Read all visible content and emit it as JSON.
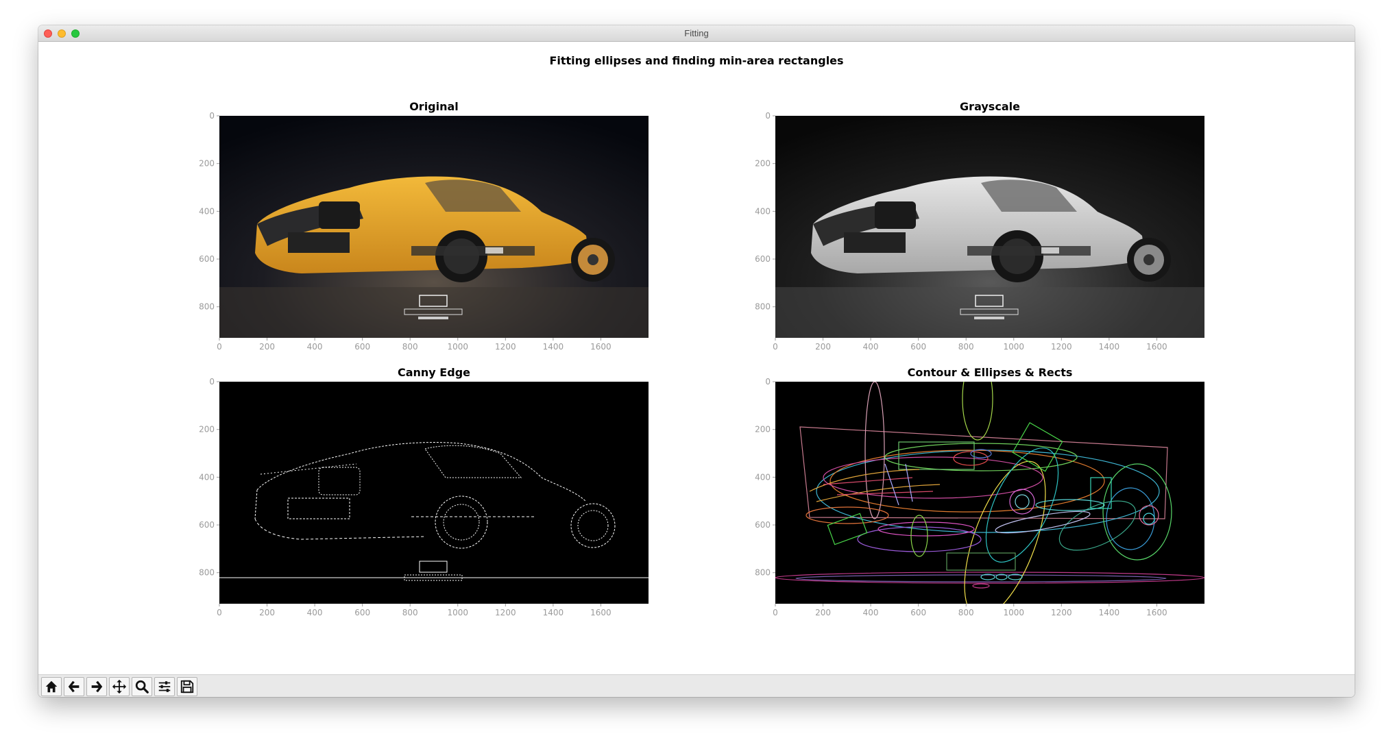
{
  "window": {
    "title": "Fitting"
  },
  "figure": {
    "suptitle": "Fitting ellipses and finding min-area rectangles"
  },
  "axes": [
    {
      "title": "Original",
      "xticks": [
        "0",
        "200",
        "400",
        "600",
        "800",
        "1000",
        "1200",
        "1400",
        "1600"
      ],
      "yticks": [
        "0",
        "200",
        "400",
        "600",
        "800"
      ]
    },
    {
      "title": "Grayscale",
      "xticks": [
        "0",
        "200",
        "400",
        "600",
        "800",
        "1000",
        "1200",
        "1400",
        "1600"
      ],
      "yticks": [
        "0",
        "200",
        "400",
        "600",
        "800"
      ]
    },
    {
      "title": "Canny Edge",
      "xticks": [
        "0",
        "200",
        "400",
        "600",
        "800",
        "1000",
        "1200",
        "1400",
        "1600"
      ],
      "yticks": [
        "0",
        "200",
        "400",
        "600",
        "800"
      ]
    },
    {
      "title": "Contour & Ellipses & Rects",
      "xticks": [
        "0",
        "200",
        "400",
        "600",
        "800",
        "1000",
        "1200",
        "1400",
        "1600"
      ],
      "yticks": [
        "0",
        "200",
        "400",
        "600",
        "800"
      ]
    }
  ],
  "toolbar": {
    "buttons": [
      {
        "icon": "home-icon"
      },
      {
        "icon": "back-arrow-icon"
      },
      {
        "icon": "forward-arrow-icon"
      },
      {
        "icon": "pan-icon"
      },
      {
        "icon": "zoom-icon"
      },
      {
        "icon": "configure-subplots-icon"
      },
      {
        "icon": "save-icon"
      }
    ]
  },
  "colors": {
    "titlebar": "#e3e3e3",
    "toolbar": "#e9e9e9",
    "tick": "#9a9a9a",
    "car_yellow": "#e8a92a"
  }
}
